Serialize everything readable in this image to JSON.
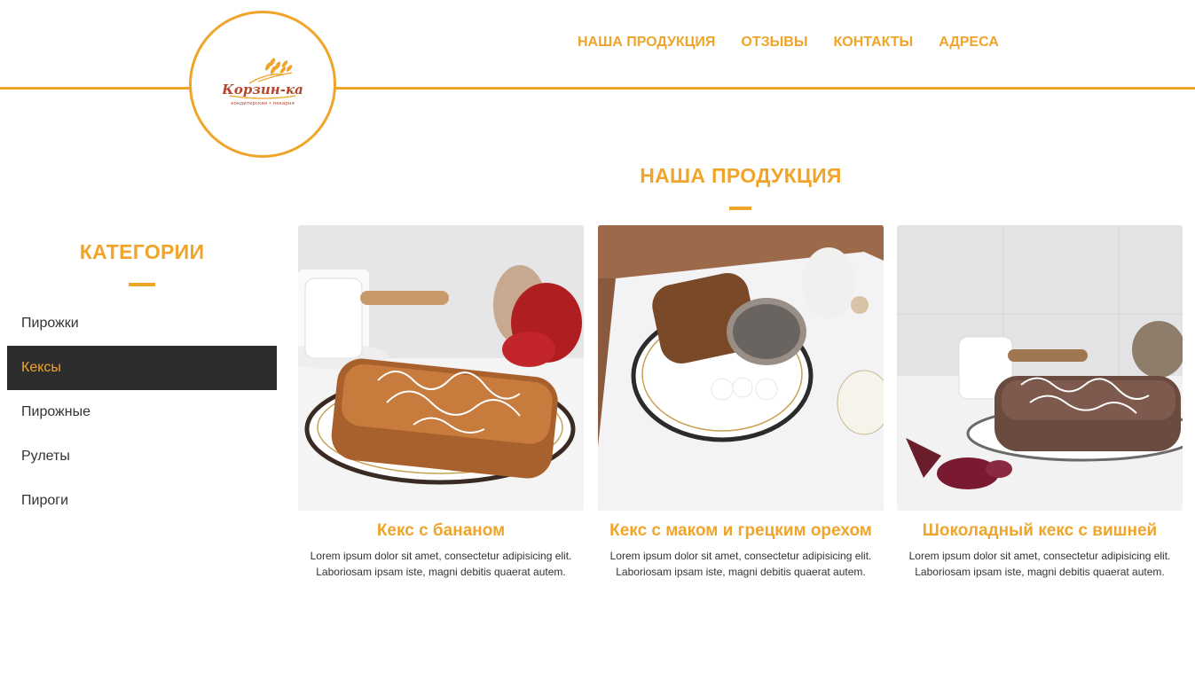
{
  "header": {
    "logo": {
      "name": "Корзин-ка",
      "tagline": "кондитерская • пекарня"
    },
    "nav": [
      "НАША ПРОДУКЦИЯ",
      "ОТЗЫВЫ",
      "КОНТАКТЫ",
      "АДРЕСА"
    ]
  },
  "colors": {
    "accent": "#f0a52a",
    "active_bg": "#2d2d2d"
  },
  "main": {
    "title": "НАША ПРОДУКЦИЯ",
    "products": [
      {
        "name": "Кекс с бананом",
        "desc_line1": "Lorem ipsum dolor sit amet, consectetur adipisicing elit.",
        "desc_line2": "Laboriosam ipsam iste, magni debitis quaerat autem."
      },
      {
        "name": "Кекс с маком и грецким орехом",
        "desc_line1": "Lorem ipsum dolor sit amet, consectetur adipisicing elit.",
        "desc_line2": "Laboriosam ipsam iste, magni debitis quaerat autem."
      },
      {
        "name": "Шоколадный кекс с вишней",
        "desc_line1": "Lorem ipsum dolor sit amet, consectetur adipisicing elit.",
        "desc_line2": "Laboriosam ipsam iste, magni debitis quaerat autem."
      }
    ]
  },
  "sidebar": {
    "title": "КАТЕГОРИИ",
    "items": [
      "Пирожки",
      "Кексы",
      "Пирожные",
      "Рулеты",
      "Пироги"
    ],
    "active_item": "Кексы"
  }
}
